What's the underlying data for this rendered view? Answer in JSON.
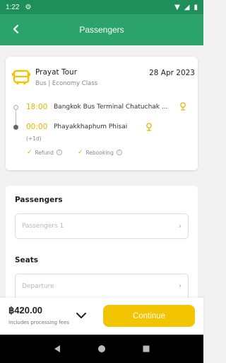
{
  "status_bar": {
    "time": "1:22"
  },
  "header": {
    "title": "Passengers"
  },
  "trip": {
    "operator": "Prayat Tour",
    "class_label": "Bus | Economy Class",
    "date": "28 Apr 2023",
    "departure": {
      "time": "18:00",
      "station": "Bangkok Bus Terminal Chatuchak ..."
    },
    "arrival": {
      "time": "00:00",
      "station": "Phayakkhaphum Phisai",
      "day_offset": "(+1d)"
    },
    "features": [
      "Refund",
      "Rebooking"
    ]
  },
  "form": {
    "passengers": {
      "title": "Passengers",
      "placeholder": "Passengers 1"
    },
    "seats": {
      "title": "Seats",
      "placeholder": "Departure"
    }
  },
  "footer": {
    "price": "฿420.00",
    "fees_note": "Includes processing fees",
    "continue_label": "Continue"
  },
  "colors": {
    "primary": "#2ba36a",
    "accent": "#f2c500",
    "status_bar": "#1f8f5a"
  },
  "icons": [
    "back-arrow-icon",
    "bus-icon",
    "location-pin-icon",
    "check-icon",
    "info-icon",
    "chevron-right-icon",
    "chevron-down-icon"
  ]
}
